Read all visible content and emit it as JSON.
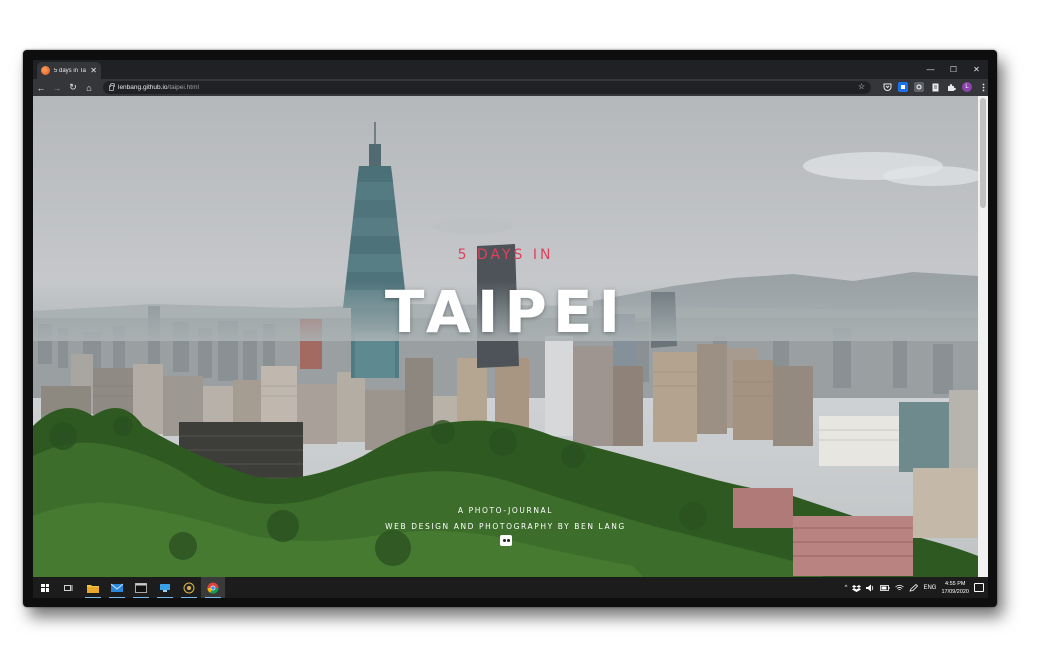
{
  "browser": {
    "tab_title": "5 days in Tai",
    "tab_close": "✕",
    "url_host": "lenbang.github.io",
    "url_path": "/taipei.html",
    "window_controls": {
      "minimize": "—",
      "maximize": "☐",
      "close": "✕"
    },
    "nav": {
      "back": "←",
      "forward": "→",
      "reload": "↻",
      "home": "⌂"
    },
    "star": "☆",
    "profile_initial": "L"
  },
  "page": {
    "subtitle": "5 DAYS IN",
    "title": "TAIPEI",
    "tagline": "A PHOTO-JOURNAL",
    "credit": "WEB DESIGN AND PHOTOGRAPHY BY BEN LANG",
    "icon": "flickr-icon"
  },
  "colors": {
    "subtitle": "#e0405a",
    "title": "#ffffff",
    "chrome_dark": "#202124",
    "chrome_toolbar": "#35363a",
    "taskbar": "#1c1c1c"
  },
  "taskbar": {
    "language": "ENG",
    "time": "4:55 PM",
    "date": "17/09/2020"
  }
}
